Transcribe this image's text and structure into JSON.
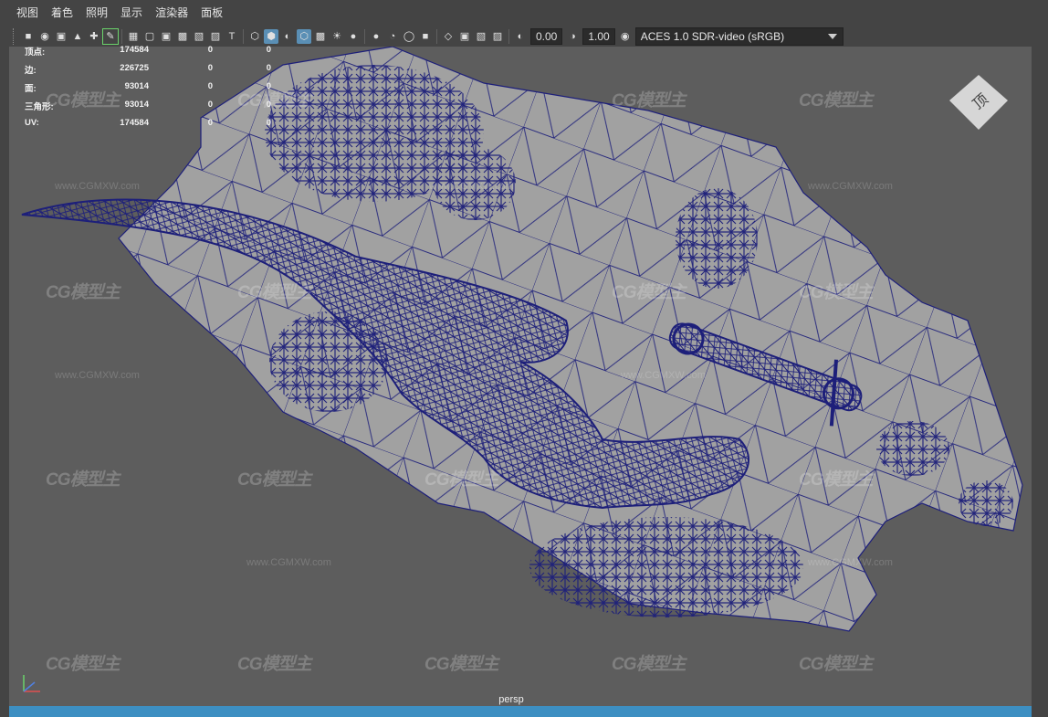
{
  "menu": [
    "视图",
    "着色",
    "照明",
    "显示",
    "渲染器",
    "面板"
  ],
  "toolbar": {
    "exposure_value": "0.00",
    "gamma_value": "1.00",
    "color_space": "ACES 1.0 SDR-video (sRGB)"
  },
  "hud": {
    "rows": [
      {
        "label": "顶点:",
        "v1": "174584",
        "v2": "0",
        "v3": "0"
      },
      {
        "label": "边:",
        "v1": "226725",
        "v2": "0",
        "v3": "0"
      },
      {
        "label": "面:",
        "v1": "93014",
        "v2": "0",
        "v3": "0"
      },
      {
        "label": "三角形:",
        "v1": "93014",
        "v2": "0",
        "v3": "0"
      },
      {
        "label": "UV:",
        "v1": "174584",
        "v2": "0",
        "v3": "0"
      }
    ]
  },
  "watermark": {
    "text": "CG模型主",
    "url": "www.CGMXW.com"
  },
  "viewport": {
    "camera": "persp",
    "view_cube_label": "顶"
  },
  "colors": {
    "wire": "#1d1f7a",
    "terrain": "#a1a1a1",
    "viewport_bg": "#5d5d5d",
    "accent": "#3d8fc2"
  }
}
